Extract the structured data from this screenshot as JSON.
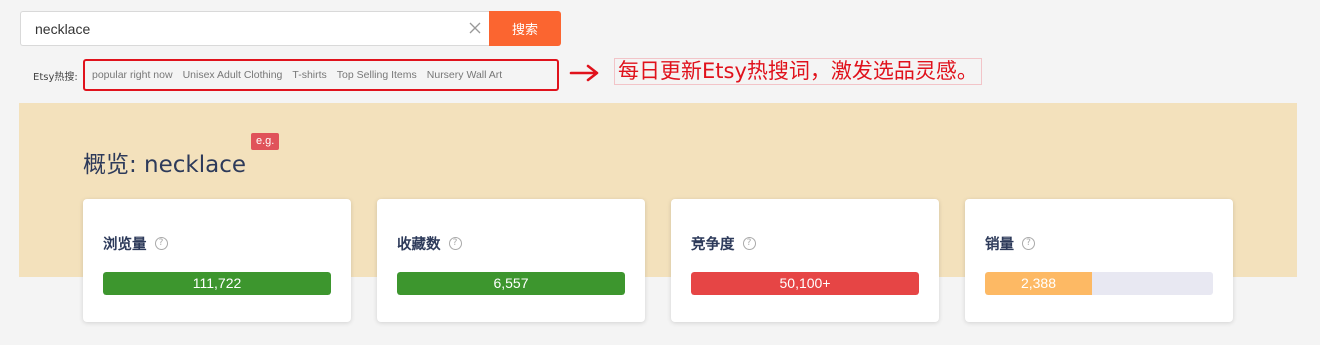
{
  "search": {
    "value": "necklace",
    "button_label": "搜索"
  },
  "hot_searches": {
    "label": "Etsy热搜:",
    "items": [
      "popular right now",
      "Unisex Adult Clothing",
      "T-shirts",
      "Top Selling Items",
      "Nursery Wall Art"
    ]
  },
  "annotation": {
    "text": "每日更新Etsy热搜词，激发选品灵感。",
    "color": "#e0121c"
  },
  "overview": {
    "title": "概览: necklace",
    "badge": "e.g.",
    "background": "#f3e1bc"
  },
  "metrics": [
    {
      "label": "浏览量",
      "value": "111,722",
      "fill": 1.0,
      "color": "#3d962e"
    },
    {
      "label": "收藏数",
      "value": "6,557",
      "fill": 1.0,
      "color": "#3d962e"
    },
    {
      "label": "竞争度",
      "value": "50,100+",
      "fill": 1.0,
      "color": "#e64545"
    },
    {
      "label": "销量",
      "value": "2,388",
      "fill": 0.47,
      "color": "#fdb964"
    }
  ],
  "icons": {
    "clear": "close-icon",
    "help": "question-circle-icon",
    "arrow": "arrow-right-icon"
  }
}
